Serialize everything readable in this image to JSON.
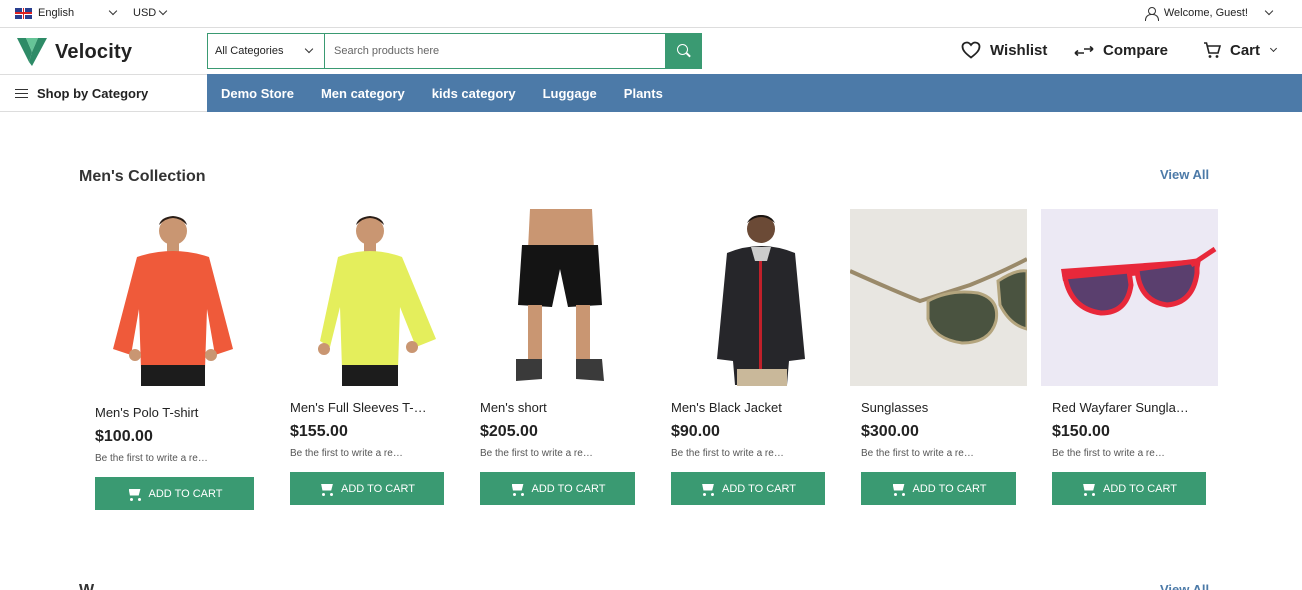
{
  "topbar": {
    "language": "English",
    "currency": "USD",
    "welcome": "Welcome, Guest!"
  },
  "header": {
    "logo_text": "Velocity",
    "search": {
      "category": "All Categories",
      "placeholder": "Search products here"
    },
    "wishlist": "Wishlist",
    "compare": "Compare",
    "cart": "Cart"
  },
  "nav": {
    "shop_by_category": "Shop by Category",
    "categories": [
      "Demo Store",
      "Men category",
      "kids category",
      "Luggage",
      "Plants"
    ]
  },
  "section": {
    "title": "Men's Collection",
    "view_all": "View All",
    "add_to_cart": "ADD TO CART",
    "products": [
      {
        "name": "Men's Polo T-shirt",
        "price": "$100.00",
        "review": "Be the first to write a re…"
      },
      {
        "name": "Men's Full Sleeves T-…",
        "price": "$155.00",
        "review": "Be the first to write a re…"
      },
      {
        "name": "Men's short",
        "price": "$205.00",
        "review": "Be the first to write a re…"
      },
      {
        "name": "Men's Black Jacket",
        "price": "$90.00",
        "review": "Be the first to write a re…"
      },
      {
        "name": "Sunglasses",
        "price": "$300.00",
        "review": "Be the first to write a re…"
      },
      {
        "name": "Red Wayfarer Sungla…",
        "price": "$150.00",
        "review": "Be the first to write a re…"
      }
    ]
  },
  "section2": {
    "title": "W…",
    "view_all": "View All"
  },
  "colors": {
    "brand_green": "#3a9a72",
    "nav_blue": "#4c7aa8"
  }
}
